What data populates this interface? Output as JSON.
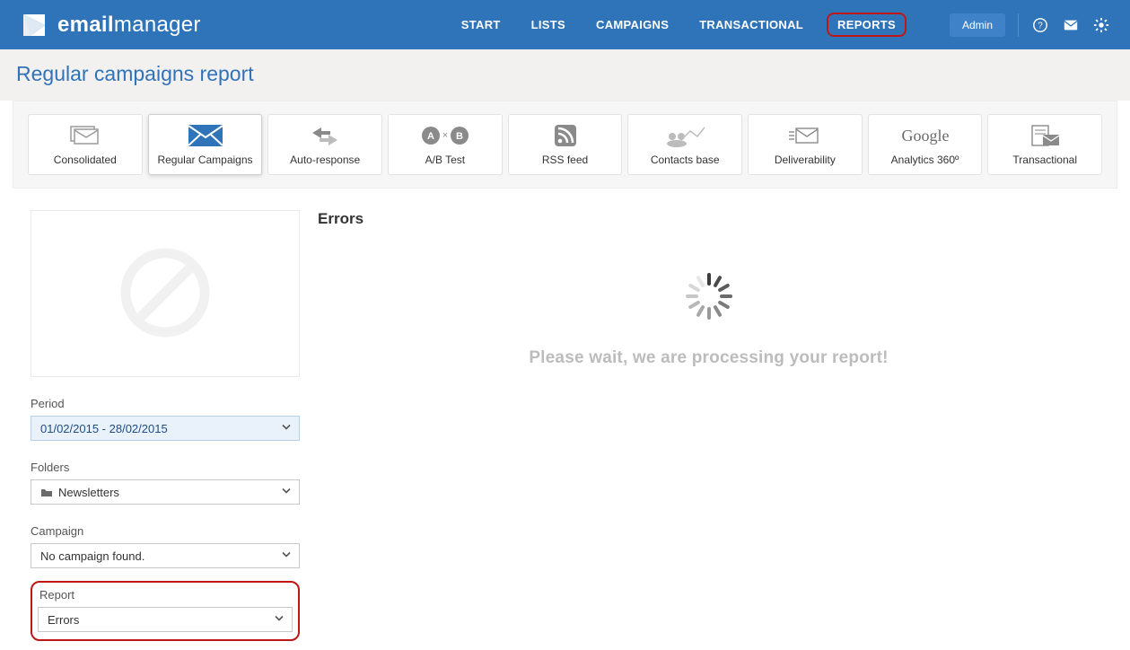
{
  "brand": {
    "name_a": "email",
    "name_b": "manager"
  },
  "nav": {
    "items": [
      "START",
      "LISTS",
      "CAMPAIGNS",
      "TRANSACTIONAL",
      "REPORTS"
    ],
    "highlighted_index": 4
  },
  "user": {
    "label": "Admin"
  },
  "page": {
    "title": "Regular campaigns report"
  },
  "tabs": [
    {
      "label": "Consolidated",
      "icon": "stack-envelope"
    },
    {
      "label": "Regular Campaigns",
      "icon": "envelope-blue"
    },
    {
      "label": "Auto-response",
      "icon": "arrows-lr"
    },
    {
      "label": "A/B Test",
      "icon": "ab-circles"
    },
    {
      "label": "RSS feed",
      "icon": "rss"
    },
    {
      "label": "Contacts base",
      "icon": "people-line"
    },
    {
      "label": "Deliverability",
      "icon": "envelope-send"
    },
    {
      "label": "Analytics 360º",
      "icon": "google-text"
    },
    {
      "label": "Transactional",
      "icon": "doc-envelope"
    }
  ],
  "active_tab_index": 1,
  "filters": {
    "period": {
      "label": "Period",
      "value": "01/02/2015 - 28/02/2015"
    },
    "folders": {
      "label": "Folders",
      "value": "Newsletters"
    },
    "campaign": {
      "label": "Campaign",
      "value": "No campaign found."
    },
    "report": {
      "label": "Report",
      "value": "Errors"
    }
  },
  "main": {
    "heading": "Errors",
    "loading_text": "Please wait, we are processing your report!"
  }
}
